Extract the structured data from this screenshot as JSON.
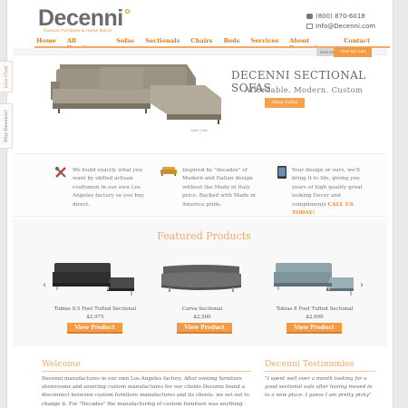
{
  "brand": {
    "name": "Decenni",
    "tagline": "Custom Furniture & Home Decor"
  },
  "contact": {
    "phone": "(800) 870-6018",
    "email": "Info@Decenni.com"
  },
  "nav": [
    "Home",
    "All Furniture",
    "Sofas",
    "Sectionals",
    "Chairs",
    "Beds",
    "Services",
    "About Decenni",
    "Contact"
  ],
  "hero": {
    "title": "DECENNI SECTIONAL SOFAS",
    "subtitle": "Affordable. Modern. Custom",
    "shop_button": "Shop Sofas",
    "caption": "Juliet Cafe",
    "top_button_grey": "New Items",
    "top_button_orange": "View My Cart"
  },
  "side_tabs": {
    "chat": "Live Chat",
    "why": "Why Decenni?"
  },
  "features": [
    {
      "icon": "tools-icon",
      "text": "We build exactly what you want by skilled artisan craftsmen in our own Los Angeles factory so you buy direct."
    },
    {
      "icon": "sofa-icon",
      "text": "Inspired by \"decades\" of Modern and Italian design without the Made in Italy price. Backed with Made in America pride."
    },
    {
      "icon": "tablet-icon",
      "text": "Your design or ours, we'll bring it to life, giving you years of high quality great looking Decor and compliments",
      "cta": "CALL US TODAY!"
    }
  ],
  "featured": {
    "title": "Featured Products",
    "products": [
      {
        "name": "Tobias 9.5 Foot Tufted Sectional",
        "price": "$2,975",
        "button": "View Product",
        "color": "#3d3d3d"
      },
      {
        "name": "Curva Sectional",
        "price": "$2,500",
        "button": "View Product",
        "color": "#6d6d6d"
      },
      {
        "name": "Tobias 8 Foot Tufted Sectional",
        "price": "$2,600",
        "button": "View Product",
        "color": "#8fa4ad"
      }
    ]
  },
  "welcome": {
    "title": "Welcome",
    "text": "Decenni manufactures in our own Los Angeles factory. After owning furniture showrooms and sourcing custom manufactures for our clients Decenni found a disconnect between custom furniture manufactures and its clients. we set out to change it. For \"Decades\" the manufacturing of custom furniture was anything but custom. it was cookie cutter designs, of sofas, chairs, beds and more mostly run out of"
  },
  "testimonials": {
    "title": "Decenni Testimonies",
    "text": "\"I spent well over a month looking for a good sectional sofa after having moved in to a new place. I guess I am pretty picky\""
  },
  "colors": {
    "accent": "#f39a45",
    "nav": "#e07a1e",
    "heading": "#f3a86a"
  }
}
